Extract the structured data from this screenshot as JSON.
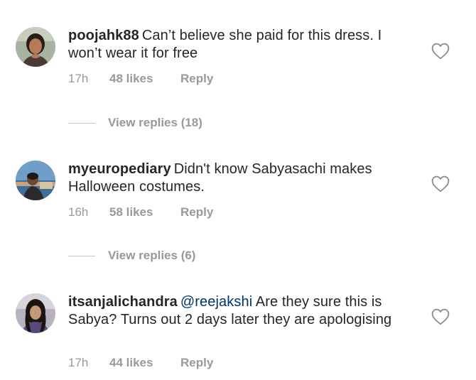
{
  "comments": [
    {
      "username": "poojahk88",
      "mention": "",
      "text": "Can’t believe she paid for this dress. I won’t wear it for free",
      "time": "17h",
      "likes": "48 likes",
      "reply_label": "Reply",
      "view_replies": "View replies (18)"
    },
    {
      "username": "myeuropediary",
      "mention": "",
      "text": "Didn't know Sabyasachi makes Halloween costumes.",
      "time": "16h",
      "likes": "58 likes",
      "reply_label": "Reply",
      "view_replies": "View replies (6)"
    },
    {
      "username": "itsanjalichandra",
      "mention": "@reejakshi",
      "text": "Are they sure this is Sabya? Turns out 2 days later they are apologising",
      "time": "17h",
      "likes": "44 likes",
      "reply_label": "Reply"
    }
  ],
  "icons": {
    "like": "heart-outline-icon"
  },
  "colors": {
    "text": "#262626",
    "meta": "#999999",
    "mention": "#003569"
  }
}
